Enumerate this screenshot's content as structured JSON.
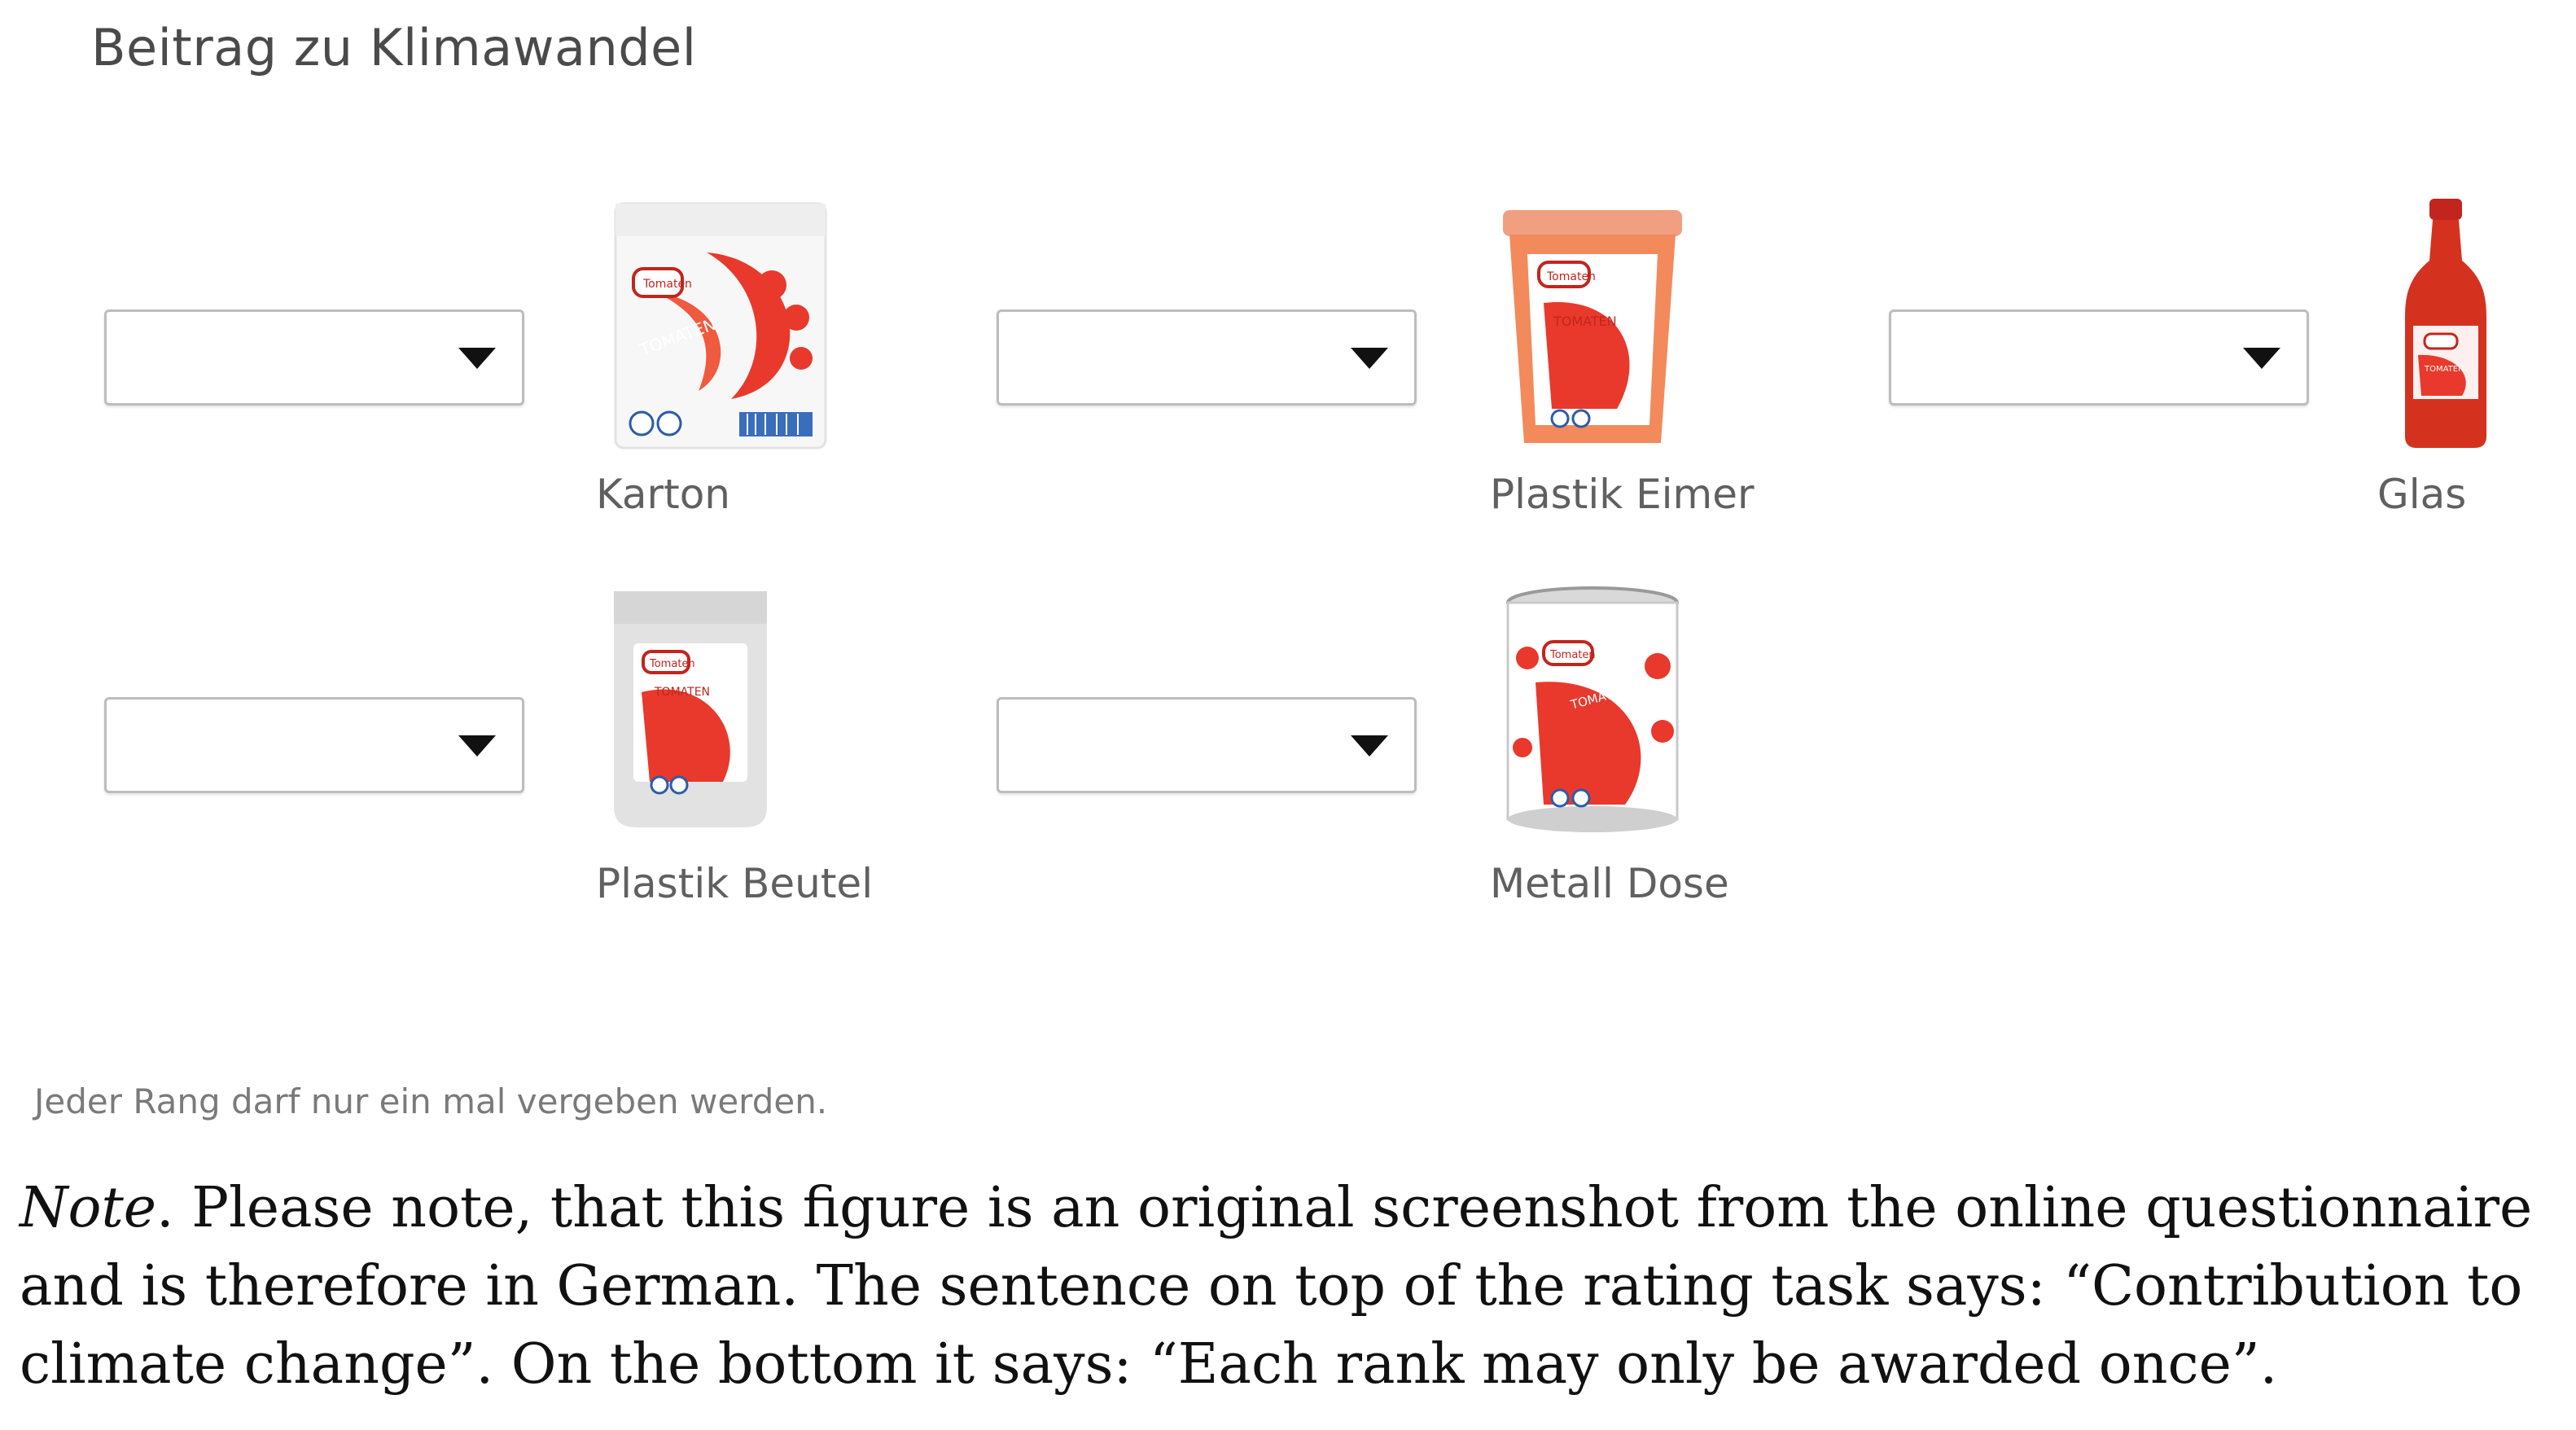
{
  "title": "Beitrag zu Klimawandel",
  "rank_value": "",
  "products": [
    {
      "label": "Karton",
      "icon": "tomato-carton-icon",
      "icon_text": "TOMATEN"
    },
    {
      "label": "Plastik Eimer",
      "icon": "tomato-plastic-bucket-icon",
      "icon_text": "TOMATEN"
    },
    {
      "label": "Glas",
      "icon": "tomato-glass-bottle-icon",
      "icon_text": "TOMATEN"
    },
    {
      "label": "Plastik Beutel",
      "icon": "tomato-plastic-bag-icon",
      "icon_text": "TOMATEN"
    },
    {
      "label": "Metall Dose",
      "icon": "tomato-metal-can-icon",
      "icon_text": "TOMATEN"
    }
  ],
  "brand_badge": "Tomaten",
  "hint": "Jeder Rang darf nur ein mal vergeben werden.",
  "note": {
    "lead": "Note",
    "text": ". Please note, that this figure is an original screenshot from the online questionnaire and is therefore in German. The sentence on top of the rating task says: “Contribution to climate change”. On the bottom it says: “Each rank may only be awarded once”."
  },
  "colors": {
    "accent_red": "#e8392c",
    "caret": "#111111",
    "border": "#bdbdbd"
  }
}
